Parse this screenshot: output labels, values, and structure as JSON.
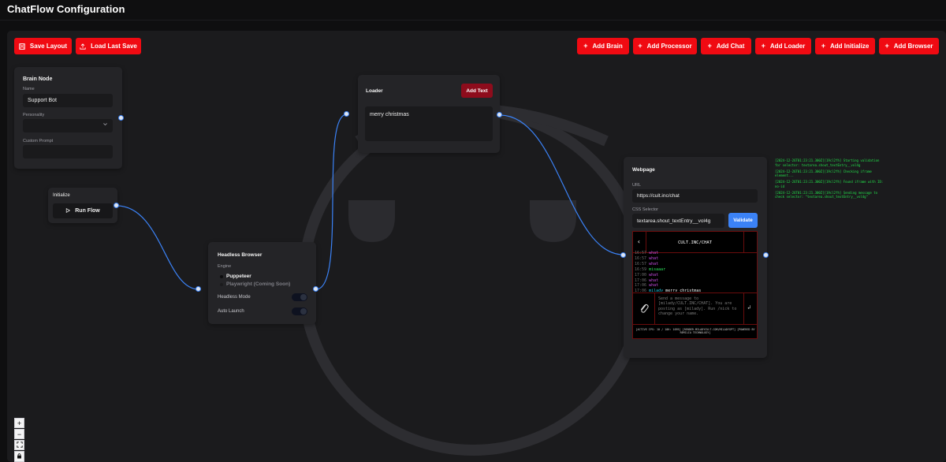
{
  "app": {
    "title": "ChatFlow Configuration"
  },
  "toolbar": {
    "save_layout": "Save Layout",
    "load_last_save": "Load Last Save",
    "add_brain": "Add Brain",
    "add_processor": "Add Processor",
    "add_chat": "Add Chat",
    "add_loader": "Add Loader",
    "add_initialize": "Add Initialize",
    "add_browser": "Add Browser"
  },
  "brain_node": {
    "title": "Brain Node",
    "name_label": "Name",
    "name_value": "Support Bot",
    "personality_label": "Personality",
    "personality_value": "",
    "custom_prompt_label": "Custom Prompt",
    "custom_prompt_value": ""
  },
  "initialize_node": {
    "title": "Initialize",
    "run_flow": "Run Flow"
  },
  "loader_node": {
    "title": "Loader",
    "add_text": "Add Text",
    "text_value": "merry christmas"
  },
  "headless_node": {
    "title": "Headless Browser",
    "engine_label": "Engine",
    "engine_option_1": "Puppeteer",
    "engine_option_2": "Playwright (Coming Soon)",
    "headless_mode_label": "Headless Mode",
    "auto_launch_label": "Auto Launch"
  },
  "webpage_node": {
    "title": "Webpage",
    "url_label": "URL",
    "url_value": "https://cult.inc/chat",
    "selector_label": "CSS Selector",
    "selector_value": "textarea.shout_textEntry__vol4g",
    "validate": "Validate"
  },
  "embedded_chat": {
    "header": "CULT.INC/CHAT",
    "messages": [
      {
        "time": "16:57",
        "user": "",
        "text": "what"
      },
      {
        "time": "16:57",
        "user": "",
        "text": "what"
      },
      {
        "time": "16:57",
        "user": "",
        "text": "what"
      },
      {
        "time": "16:59",
        "user": "",
        "text": "misaaar"
      },
      {
        "time": "17:00",
        "user": "",
        "text": "what"
      },
      {
        "time": "17:06",
        "user": "",
        "text": "what"
      },
      {
        "time": "17:06",
        "user": "",
        "text": "what"
      },
      {
        "time": "17:06",
        "user": "milady",
        "text": "merry christmas"
      }
    ],
    "input_placeholder": "Send a message to [milady/CULT.INC/CHAT]. You are posting as [milady]. Run /nick to change your name.",
    "footer": "[ACTIVE IPS: 10 / 10H: 1095] [RENDER.MILADYCULT.COM/MILADYGPT] [POWERED BY REMILIA TECHNOLOGY]"
  },
  "logs": [
    "[2024-12-26T01:23:21.300Z][19cl2fh] Starting validation for selector: textarea.shout_textEntry__vol4g",
    "[2024-12-26T01:23:21.300Z][19cl2fh] Checking iframe element...",
    "[2024-12-26T01:23:21.300Z][19cl2fh] Found iframe with ID: no-id",
    "[2024-12-26T01:23:21.300Z][19cl2fh] Sending message to check selector: \"textarea.shout_textEntry__vol4g\""
  ],
  "zoom_controls": {
    "zoom_in": "+",
    "zoom_out": "−"
  },
  "colors": {
    "accent_red": "#f00a12",
    "dark_red": "#8e0c1c",
    "accent_blue": "#3b82f6",
    "log_green": "#22e04a"
  }
}
